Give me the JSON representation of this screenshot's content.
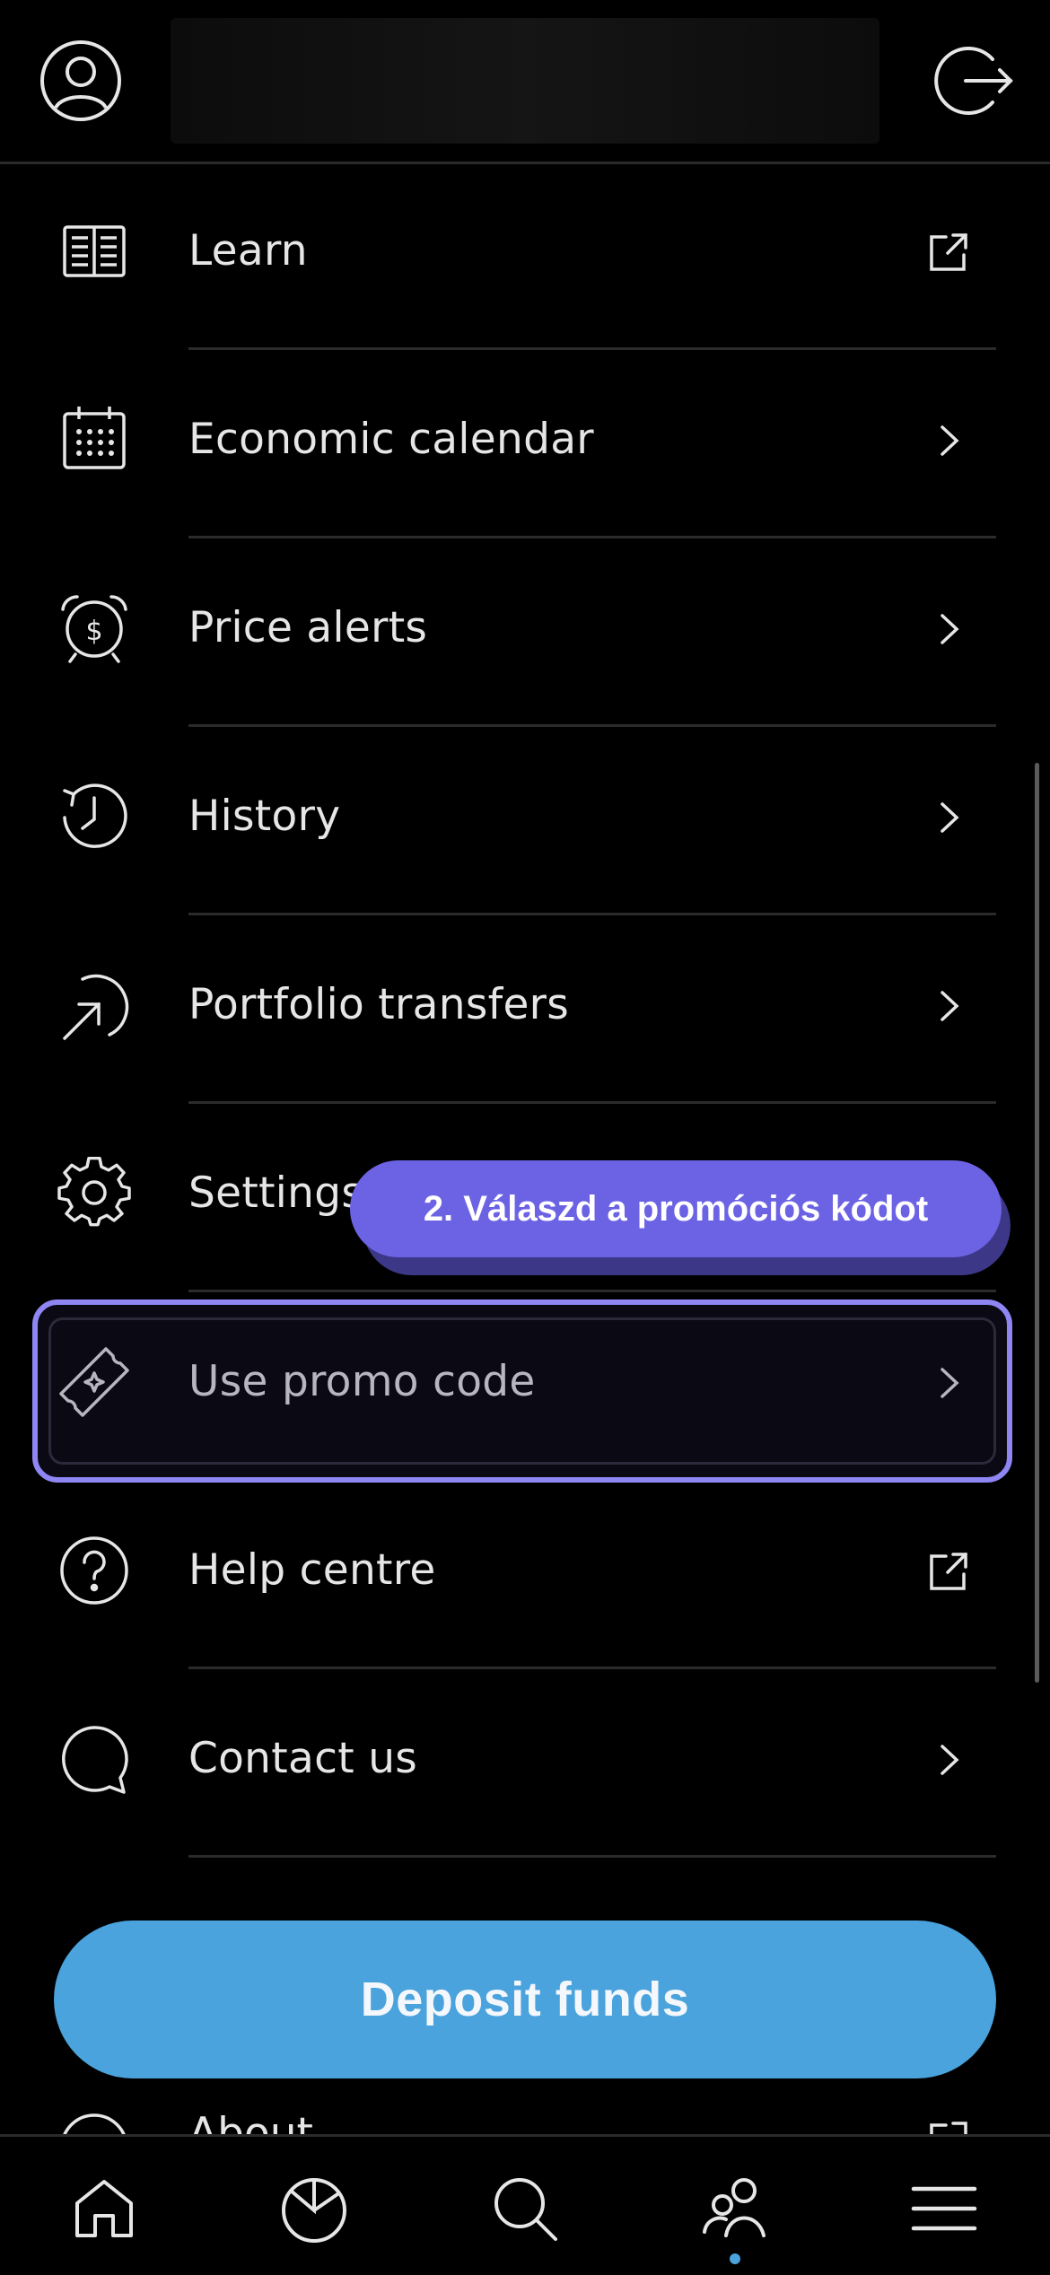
{
  "header": {
    "profile_icon": "user-circle-icon",
    "logout_icon": "logout-icon"
  },
  "menu": {
    "items": [
      {
        "label": "Learn",
        "icon": "book-icon",
        "trailing": "external-link-icon"
      },
      {
        "label": "Economic calendar",
        "icon": "calendar-icon",
        "trailing": "chevron-right-icon"
      },
      {
        "label": "Price alerts",
        "icon": "alarm-clock-dollar-icon",
        "trailing": "chevron-right-icon"
      },
      {
        "label": "History",
        "icon": "history-clock-icon",
        "trailing": "chevron-right-icon"
      },
      {
        "label": "Portfolio transfers",
        "icon": "transfer-arrow-icon",
        "trailing": "chevron-right-icon"
      },
      {
        "label": "Settings",
        "icon": "gear-icon",
        "trailing": "chevron-right-icon"
      },
      {
        "label": "Use promo code",
        "icon": "ticket-icon",
        "trailing": "chevron-right-icon"
      },
      {
        "label": "Help centre",
        "icon": "question-circle-icon",
        "trailing": "external-link-icon"
      },
      {
        "label": "Contact us",
        "icon": "chat-bubble-icon",
        "trailing": "chevron-right-icon"
      }
    ],
    "peek_label": "About"
  },
  "tooltip": {
    "text": "2. Válaszd a promóciós kódot"
  },
  "deposit": {
    "label": "Deposit funds"
  },
  "tabbar": {
    "tabs": [
      {
        "icon": "home-icon"
      },
      {
        "icon": "portfolio-pie-icon"
      },
      {
        "icon": "search-icon"
      },
      {
        "icon": "social-people-icon",
        "active": true
      },
      {
        "icon": "menu-icon"
      }
    ]
  },
  "colors": {
    "background": "#000000",
    "accent_blue": "#4aa3dc",
    "tooltip_purple": "#6c63e4",
    "highlight_border": "#8f86f4",
    "text": "#e6e6e6"
  }
}
